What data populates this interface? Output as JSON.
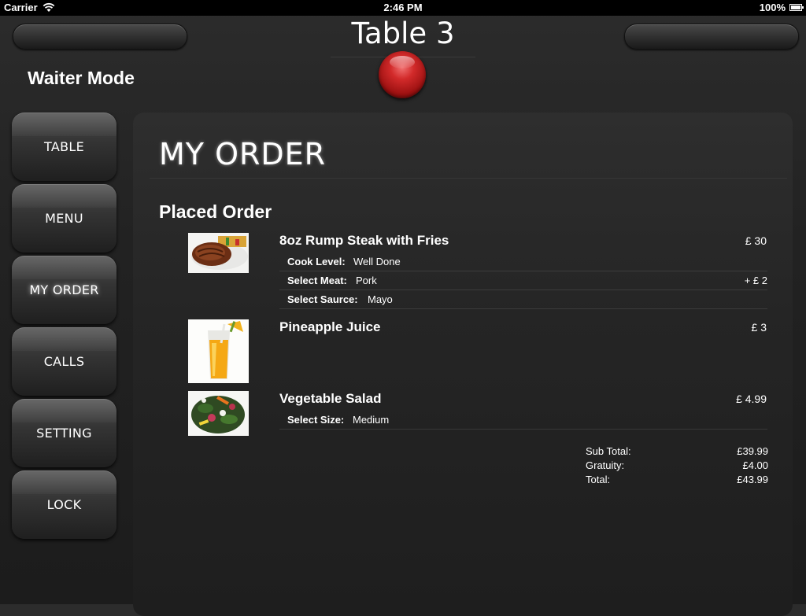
{
  "status_bar": {
    "carrier": "Carrier",
    "time": "2:46 PM",
    "battery": "100%"
  },
  "header": {
    "title": "Table 3",
    "mode": "Waiter Mode"
  },
  "sidebar": {
    "items": [
      {
        "label": "TABLE"
      },
      {
        "label": "MENU"
      },
      {
        "label": "MY ORDER"
      },
      {
        "label": "CALLS"
      },
      {
        "label": "SETTING"
      },
      {
        "label": "LOCK"
      }
    ],
    "active": "MY ORDER"
  },
  "main": {
    "title": "MY ORDER",
    "section": "Placed Order",
    "items": [
      {
        "name": "8oz Rump Steak with Fries",
        "price": "£ 30",
        "image": "steak-photo",
        "options": [
          {
            "label": "Cook Level:",
            "value": "Well Done",
            "extra": ""
          },
          {
            "label": "Select Meat:",
            "value": "Pork",
            "extra": "+ £ 2"
          },
          {
            "label": "Select Saurce:",
            "value": "Mayo",
            "extra": ""
          }
        ]
      },
      {
        "name": "Pineapple Juice",
        "price": "£ 3",
        "image": "juice-photo",
        "options": []
      },
      {
        "name": "Vegetable Salad",
        "price": "£ 4.99",
        "image": "salad-photo",
        "options": [
          {
            "label": "Select Size:",
            "value": "Medium",
            "extra": ""
          }
        ]
      }
    ],
    "totals": {
      "subtotal_label": "Sub Total:",
      "subtotal": "£39.99",
      "gratuity_label": "Gratuity:",
      "gratuity": "£4.00",
      "total_label": "Total:",
      "total": "£43.99"
    }
  },
  "colors": {
    "accent_red": "#c41e1e",
    "background": "#222222",
    "text": "#ffffff"
  }
}
